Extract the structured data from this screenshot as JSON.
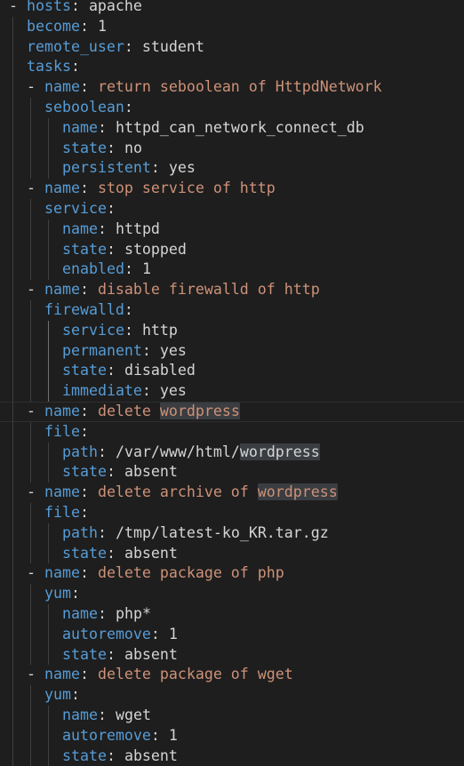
{
  "colors": {
    "background": "#1e1e1e",
    "key": "#569cd6",
    "string": "#ce9178",
    "plain": "#d4d4d4",
    "word_highlight": "#3a3d41"
  },
  "editor": {
    "language": "yaml",
    "highlighted_word": "wordpress",
    "lines": [
      {
        "indent": 0,
        "dash": true,
        "key": "hosts",
        "value": "apache",
        "kind": "plain"
      },
      {
        "indent": 1,
        "key": "become",
        "value": "1",
        "kind": "plain"
      },
      {
        "indent": 1,
        "key": "remote_user",
        "value": "student",
        "kind": "plain"
      },
      {
        "indent": 1,
        "key": "tasks",
        "value": "",
        "kind": "plain"
      },
      {
        "indent": 1,
        "dash": true,
        "key": "name",
        "value": "return seboolean of HttpdNetwork",
        "kind": "string"
      },
      {
        "indent": 2,
        "key": "seboolean",
        "value": "",
        "kind": "plain"
      },
      {
        "indent": 3,
        "key": "name",
        "value": "httpd_can_network_connect_db",
        "kind": "plain"
      },
      {
        "indent": 3,
        "key": "state",
        "value": "no",
        "kind": "plain"
      },
      {
        "indent": 3,
        "key": "persistent",
        "value": "yes",
        "kind": "plain"
      },
      {
        "indent": 1,
        "dash": true,
        "key": "name",
        "value": "stop service of http",
        "kind": "string"
      },
      {
        "indent": 2,
        "key": "service",
        "value": "",
        "kind": "plain"
      },
      {
        "indent": 3,
        "key": "name",
        "value": "httpd",
        "kind": "plain"
      },
      {
        "indent": 3,
        "key": "state",
        "value": "stopped",
        "kind": "plain"
      },
      {
        "indent": 3,
        "key": "enabled",
        "value": "1",
        "kind": "plain"
      },
      {
        "indent": 1,
        "dash": true,
        "key": "name",
        "value": "disable firewalld of http",
        "kind": "string"
      },
      {
        "indent": 2,
        "key": "firewalld",
        "value": "",
        "kind": "plain"
      },
      {
        "indent": 3,
        "key": "service",
        "value": "http",
        "kind": "plain"
      },
      {
        "indent": 3,
        "key": "permanent",
        "value": "yes",
        "kind": "plain"
      },
      {
        "indent": 3,
        "key": "state",
        "value": "disabled",
        "kind": "plain"
      },
      {
        "indent": 3,
        "key": "immediate",
        "value": "yes",
        "kind": "plain"
      },
      {
        "indent": 1,
        "dash": true,
        "key": "name",
        "value": "delete wordpress",
        "kind": "string",
        "current": true
      },
      {
        "indent": 2,
        "key": "file",
        "value": "",
        "kind": "plain"
      },
      {
        "indent": 3,
        "key": "path",
        "value": "/var/www/html/wordpress",
        "kind": "plain"
      },
      {
        "indent": 3,
        "key": "state",
        "value": "absent",
        "kind": "plain"
      },
      {
        "indent": 1,
        "dash": true,
        "key": "name",
        "value": "delete archive of wordpress",
        "kind": "string"
      },
      {
        "indent": 2,
        "key": "file",
        "value": "",
        "kind": "plain"
      },
      {
        "indent": 3,
        "key": "path",
        "value": "/tmp/latest-ko_KR.tar.gz",
        "kind": "plain"
      },
      {
        "indent": 3,
        "key": "state",
        "value": "absent",
        "kind": "plain"
      },
      {
        "indent": 1,
        "dash": true,
        "key": "name",
        "value": "delete package of php",
        "kind": "string"
      },
      {
        "indent": 2,
        "key": "yum",
        "value": "",
        "kind": "plain"
      },
      {
        "indent": 3,
        "key": "name",
        "value": "php*",
        "kind": "plain"
      },
      {
        "indent": 3,
        "key": "autoremove",
        "value": "1",
        "kind": "plain"
      },
      {
        "indent": 3,
        "key": "state",
        "value": "absent",
        "kind": "plain"
      },
      {
        "indent": 1,
        "dash": true,
        "key": "name",
        "value": "delete package of wget",
        "kind": "string"
      },
      {
        "indent": 2,
        "key": "yum",
        "value": "",
        "kind": "plain"
      },
      {
        "indent": 3,
        "key": "name",
        "value": "wget",
        "kind": "plain"
      },
      {
        "indent": 3,
        "key": "autoremove",
        "value": "1",
        "kind": "plain"
      },
      {
        "indent": 3,
        "key": "state",
        "value": "absent",
        "kind": "plain"
      }
    ]
  }
}
